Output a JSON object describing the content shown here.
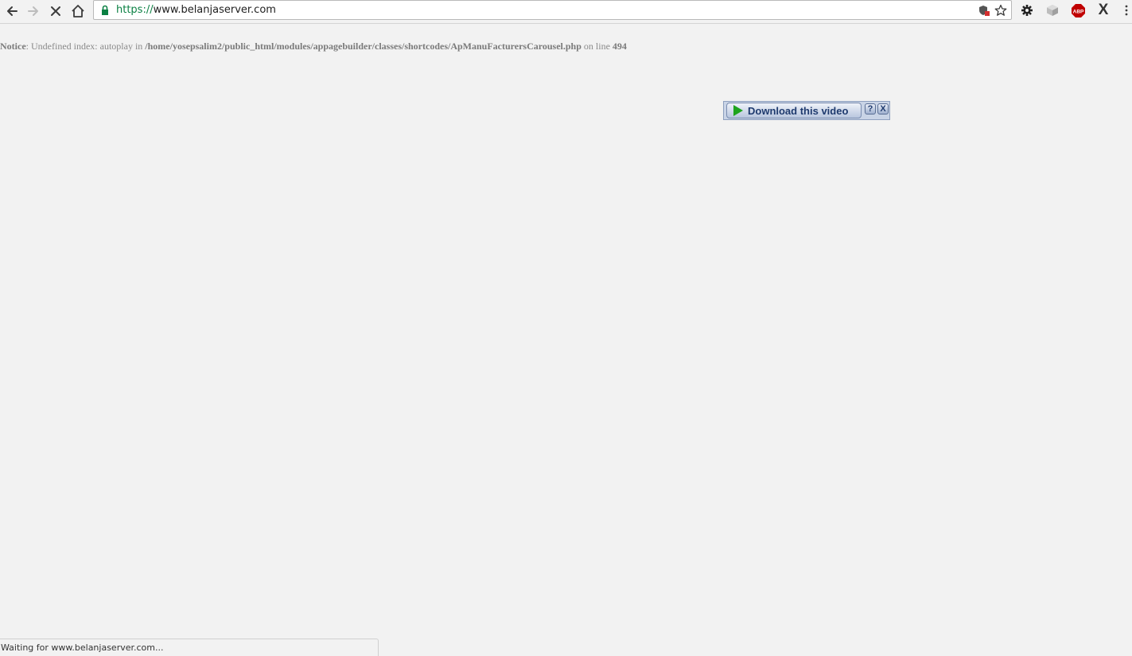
{
  "browser": {
    "url_scheme": "https://",
    "url_host": "www.belanjaserver.com",
    "icons": {
      "back": "back-arrow-icon",
      "forward": "forward-arrow-icon",
      "stop": "stop-loading-icon",
      "home": "home-icon",
      "lock": "lock-icon",
      "site_info": "shield-blocked-icon",
      "bookmark": "star-icon",
      "settings_ext": "gear-icon",
      "cube_ext": "cube-icon",
      "abp_ext": "adblock-plus-icon",
      "x_ext": "x-extension-icon",
      "menu": "kebab-menu-icon"
    },
    "abp_label": "ABP",
    "x_label": "X"
  },
  "page": {
    "notice_label": "Notice",
    "notice_text_1": ": Undefined index: autoplay in ",
    "notice_path": "/home/yosepsalim2/public_html/modules/appagebuilder/classes/shortcodes/ApManuFacturersCarousel.php",
    "notice_text_2": " on line ",
    "notice_line": "494"
  },
  "download_bar": {
    "button_label": "Download this video",
    "help_label": "?",
    "close_label": "X"
  },
  "status": {
    "text": "Waiting for www.belanjaserver.com..."
  },
  "colors": {
    "page_bg": "#f2f2f2",
    "secure_green": "#0b8043",
    "abp_red": "#c00000",
    "play_green": "#1ea41e"
  }
}
